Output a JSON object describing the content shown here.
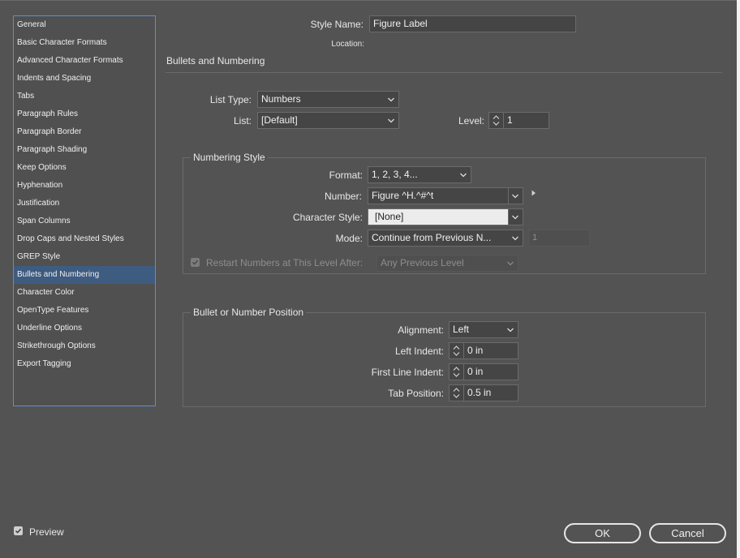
{
  "sidebar": {
    "items": [
      {
        "label": "General"
      },
      {
        "label": "Basic Character Formats"
      },
      {
        "label": "Advanced Character Formats"
      },
      {
        "label": "Indents and Spacing"
      },
      {
        "label": "Tabs"
      },
      {
        "label": "Paragraph Rules"
      },
      {
        "label": "Paragraph Border"
      },
      {
        "label": "Paragraph Shading"
      },
      {
        "label": "Keep Options"
      },
      {
        "label": "Hyphenation"
      },
      {
        "label": "Justification"
      },
      {
        "label": "Span Columns"
      },
      {
        "label": "Drop Caps and Nested Styles"
      },
      {
        "label": "GREP Style"
      },
      {
        "label": "Bullets and Numbering"
      },
      {
        "label": "Character Color"
      },
      {
        "label": "OpenType Features"
      },
      {
        "label": "Underline Options"
      },
      {
        "label": "Strikethrough Options"
      },
      {
        "label": "Export Tagging"
      }
    ],
    "selected": "Bullets and Numbering"
  },
  "header": {
    "style_name_label": "Style Name:",
    "style_name_value": "Figure Label",
    "location_label": "Location:"
  },
  "section_title": "Bullets and Numbering",
  "list": {
    "list_type_label": "List Type:",
    "list_type_value": "Numbers",
    "list_label": "List:",
    "list_value": "[Default]",
    "level_label": "Level:",
    "level_value": "1"
  },
  "numbering_style": {
    "title": "Numbering Style",
    "format_label": "Format:",
    "format_value": "1, 2, 3, 4...",
    "number_label": "Number:",
    "number_value": "Figure ^H.^#^t",
    "character_style_label": "Character Style:",
    "character_style_value": "[None]",
    "mode_label": "Mode:",
    "mode_value": "Continue from Previous N...",
    "mode_start_value": "1",
    "restart_label": "Restart Numbers at This Level After:",
    "restart_value": "Any Previous Level"
  },
  "position": {
    "title": "Bullet or Number Position",
    "alignment_label": "Alignment:",
    "alignment_value": "Left",
    "left_indent_label": "Left Indent:",
    "left_indent_value": "0 in",
    "first_line_indent_label": "First Line Indent:",
    "first_line_indent_value": "0 in",
    "tab_position_label": "Tab Position:",
    "tab_position_value": "0.5 in"
  },
  "footer": {
    "preview_label": "Preview",
    "preview_checked": true,
    "ok_label": "OK",
    "cancel_label": "Cancel"
  },
  "colors": {
    "background": "#535353",
    "selection": "#3e5b80",
    "focus_border": "#5b8fd0"
  }
}
